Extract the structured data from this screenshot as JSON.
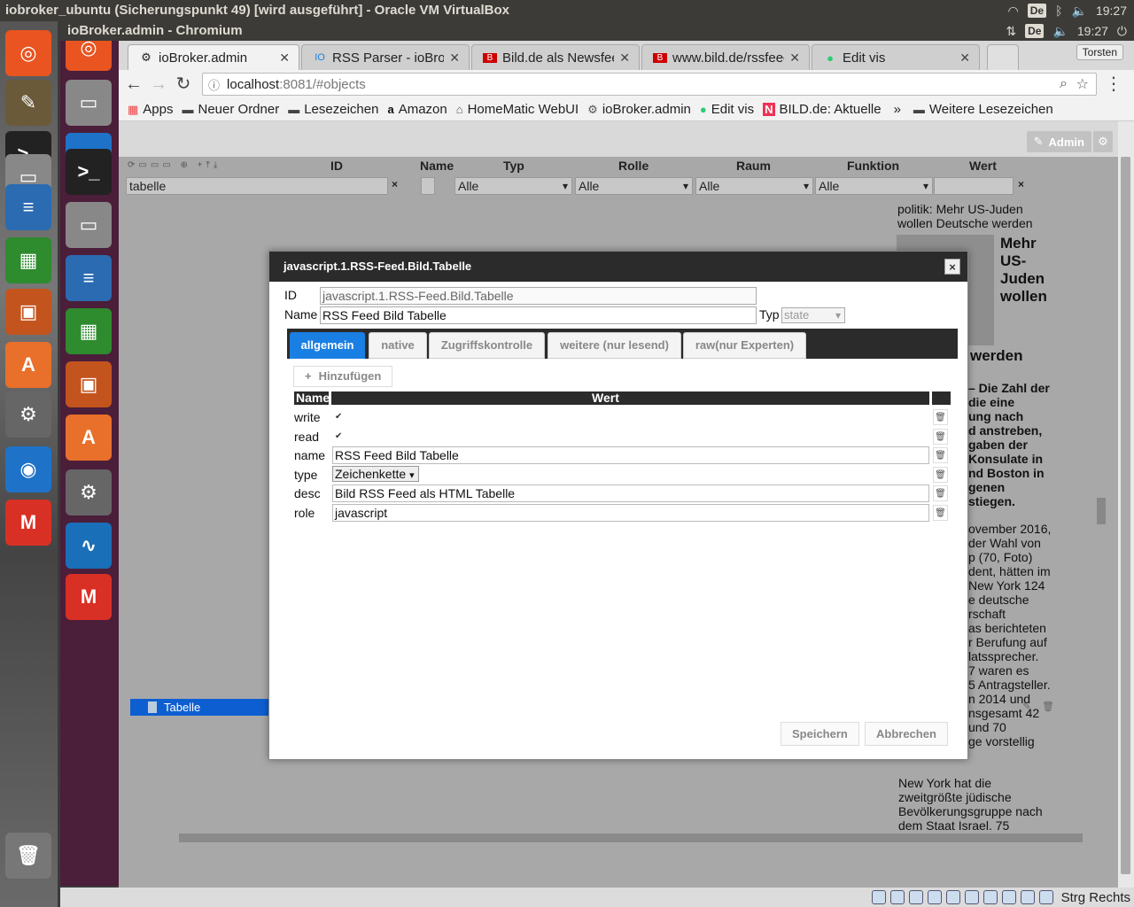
{
  "host": {
    "title": "iobroker_ubuntu (Sicherungspunkt 49) [wird ausgeführt] - Oracle VM VirtualBox",
    "keyboard": "De",
    "time": "19:27"
  },
  "chrome_window": {
    "title": "ioBroker.admin - Chromium",
    "keyboard": "De",
    "time": "19:27",
    "profile": "Torsten"
  },
  "launcher": [
    {
      "name": "ubuntu-dash-icon",
      "glyph": "◎",
      "color": "#e95420"
    },
    {
      "name": "files-icon",
      "glyph": "▭",
      "color": "#888"
    },
    {
      "name": "chromium-icon",
      "glyph": "◉",
      "color": "#1e73c9"
    },
    {
      "name": "terminal-icon",
      "glyph": ">_",
      "color": "#222"
    },
    {
      "name": "files-icon-2",
      "glyph": "▭",
      "color": "#888"
    },
    {
      "name": "writer-icon",
      "glyph": "≡",
      "color": "#2a6bb1"
    },
    {
      "name": "calc-icon",
      "glyph": "▦",
      "color": "#2e8b2e"
    },
    {
      "name": "impress-icon",
      "glyph": "▣",
      "color": "#c4541e"
    },
    {
      "name": "software-center-icon",
      "glyph": "A",
      "color": "#e9702a"
    },
    {
      "name": "system-settings-icon",
      "glyph": "⚙",
      "color": "#666"
    },
    {
      "name": "system-monitor-icon",
      "glyph": "∿",
      "color": "#1a6fb9"
    },
    {
      "name": "gmail-icon",
      "glyph": "M",
      "color": "#d93025"
    }
  ],
  "host_launcher": [
    {
      "name": "ubuntu-dash-icon",
      "glyph": "◎",
      "color": "#e95420"
    },
    {
      "name": "gimp-icon",
      "glyph": "✎",
      "color": "#6b5a3a"
    },
    {
      "name": "terminal-icon",
      "glyph": ">_",
      "color": "#222"
    },
    {
      "name": "files-icon",
      "glyph": "▭",
      "color": "#888"
    },
    {
      "name": "writer-icon",
      "glyph": "≡",
      "color": "#2a6bb1"
    },
    {
      "name": "calc-icon",
      "glyph": "▦",
      "color": "#2e8b2e"
    },
    {
      "name": "impress-icon",
      "glyph": "▣",
      "color": "#c4541e"
    },
    {
      "name": "software-center-icon",
      "glyph": "A",
      "color": "#e9702a"
    },
    {
      "name": "system-settings-icon",
      "glyph": "⚙",
      "color": "#666"
    },
    {
      "name": "chromium-icon",
      "glyph": "◉",
      "color": "#1e73c9"
    },
    {
      "name": "gmail-icon",
      "glyph": "M",
      "color": "#d93025"
    },
    {
      "name": "trash-icon",
      "glyph": "🗑",
      "color": "#777"
    }
  ],
  "tabs": [
    {
      "label": "ioBroker.admin",
      "icon": "⚙",
      "active": true
    },
    {
      "label": "RSS Parser - ioBroker",
      "icon": "IO",
      "active": false
    },
    {
      "label": "Bild.de als Newsfeed",
      "icon": "B",
      "active": false
    },
    {
      "label": "www.bild.de/rssfeeds",
      "icon": "B",
      "active": false
    },
    {
      "label": "Edit vis",
      "icon": "●",
      "active": false
    }
  ],
  "toolbar": {
    "url_host": "localhost",
    "url_rest": ":8081/#objects"
  },
  "bookmarks": [
    {
      "label": "Apps",
      "icon": "▦"
    },
    {
      "label": "Neuer Ordner",
      "icon": "▬"
    },
    {
      "label": "Lesezeichen",
      "icon": "▬"
    },
    {
      "label": "Amazon",
      "icon": "a"
    },
    {
      "label": "HomeMatic WebUI",
      "icon": "⌂"
    },
    {
      "label": "ioBroker.admin",
      "icon": "⚙"
    },
    {
      "label": "Edit vis",
      "icon": "●"
    },
    {
      "label": "BILD.de: Aktuelle",
      "icon": "N"
    }
  ],
  "bookmarks_more": "»",
  "bookmarks_other": "Weitere Lesezeichen",
  "admin": {
    "label": "Admin"
  },
  "grid": {
    "columns": [
      "ID",
      "Name",
      "Typ",
      "Rolle",
      "Raum",
      "Funktion",
      "Wert"
    ],
    "id_filter": "tabelle",
    "select_all": "Alle",
    "tree_item": "Tabelle"
  },
  "feed_text": {
    "intro": "politik: Mehr US-Juden wollen Deutsche werden",
    "headline": "Mehr US-Juden wollen",
    "headline_tail": "werden",
    "bold_lines": [
      "– Die Zahl der",
      "die eine",
      "ung nach",
      "d anstreben,",
      "gaben der",
      "Konsulate in",
      "nd Boston in",
      "genen",
      "stiegen."
    ],
    "body_lines": [
      "ovember 2016,",
      "der Wahl von",
      "p (70, Foto)",
      "dent, hätten im",
      "New York 124",
      "e deutsche",
      "rschaft",
      "as berichteten",
      "r Berufung auf",
      "latssprecher.",
      "7 waren es",
      "5 Antragsteller.",
      "n 2014 und",
      "nsgesamt 42",
      "und 70",
      "ge vorstellig"
    ],
    "outro": "New York hat die zweitgrößte jüdische Bevölkerungsgruppe nach dem Staat Israel. 75"
  },
  "dialog": {
    "title": "javascript.1.RSS-Feed.Bild.Tabelle",
    "close": "×",
    "id_label": "ID",
    "id_value": "javascript.1.RSS-Feed.Bild.Tabelle",
    "name_label": "Name",
    "name_value": "RSS Feed Bild Tabelle",
    "typ_label": "Typ",
    "typ_value": "state",
    "tabs": [
      "allgemein",
      "native",
      "Zugriffskontrolle",
      "weitere (nur lesend)",
      "raw(nur Experten)"
    ],
    "add_label": "Hinzufügen",
    "table_head_name": "Name",
    "table_head_value": "Wert",
    "rows": [
      {
        "name": "write",
        "kind": "checkbox",
        "value": "✔"
      },
      {
        "name": "read",
        "kind": "checkbox",
        "value": "✔"
      },
      {
        "name": "name",
        "kind": "text",
        "value": "RSS Feed Bild Tabelle"
      },
      {
        "name": "type",
        "kind": "select",
        "value": "Zeichenkette"
      },
      {
        "name": "desc",
        "kind": "text",
        "value": "Bild RSS Feed als HTML Tabelle"
      },
      {
        "name": "role",
        "kind": "text",
        "value": "javascript"
      }
    ],
    "save_label": "Speichern",
    "cancel_label": "Abbrechen"
  },
  "status_bar": {
    "label": "Strg Rechts"
  }
}
